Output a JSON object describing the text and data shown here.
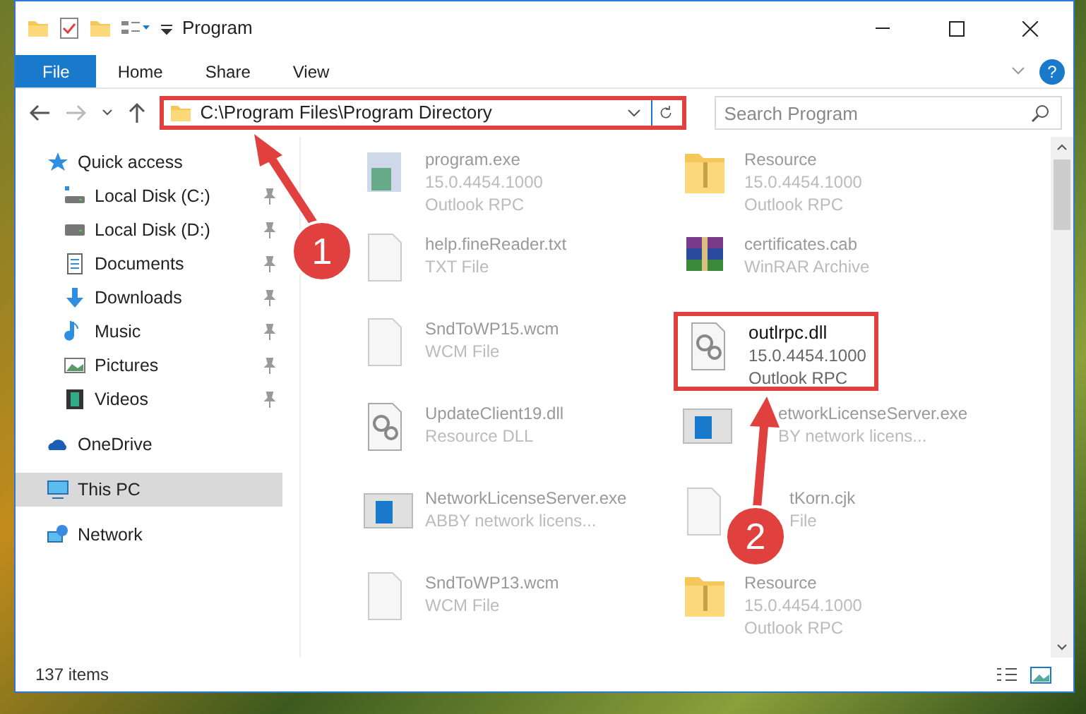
{
  "window": {
    "title": "Program"
  },
  "ribbon_tabs": [
    {
      "label": "File",
      "selected": true
    },
    {
      "label": "Home",
      "selected": false
    },
    {
      "label": "Share",
      "selected": false
    },
    {
      "label": "View",
      "selected": false
    }
  ],
  "address_bar": {
    "path": "C:\\Program Files\\Program Directory",
    "highlighted": true
  },
  "help_button": {
    "label": "?"
  },
  "search": {
    "placeholder": "Search Program"
  },
  "sidebar": {
    "items": [
      {
        "label": "Quick access",
        "selected": false,
        "children": [
          {
            "label": "Local Disk (C:)",
            "selected": false,
            "pinned": true
          },
          {
            "label": "Local Disk (D:)",
            "selected": false,
            "pinned": true
          },
          {
            "label": "Documents",
            "selected": false,
            "pinned": true
          },
          {
            "label": "Downloads",
            "selected": false,
            "pinned": true
          },
          {
            "label": "Music",
            "selected": false,
            "pinned": true
          },
          {
            "label": "Pictures",
            "selected": false,
            "pinned": true
          },
          {
            "label": "Videos",
            "selected": false,
            "pinned": true
          }
        ]
      },
      {
        "label": "OneDrive",
        "selected": false
      },
      {
        "label": "This PC",
        "selected": true
      },
      {
        "label": "Network",
        "selected": false
      }
    ]
  },
  "files": [
    {
      "name": "program.exe",
      "lines": [
        "15.0.4454.1000",
        "Outlook RPC"
      ],
      "highlighted": false
    },
    {
      "name": "Resource",
      "lines": [
        "15.0.4454.1000",
        "Outlook RPC"
      ],
      "highlighted": false
    },
    {
      "name": "help.fineReader.txt",
      "lines": [
        "TXT File"
      ],
      "highlighted": false
    },
    {
      "name": "certificates.cab",
      "lines": [
        "WinRAR Archive"
      ],
      "highlighted": false
    },
    {
      "name": "SndToWP15.wcm",
      "lines": [
        "WCM File"
      ],
      "highlighted": false
    },
    {
      "name": "outlrpc.dll",
      "lines": [
        "15.0.4454.1000",
        "Outlook RPC"
      ],
      "highlighted": true
    },
    {
      "name": "UpdateClient19.dll",
      "lines": [
        "Resource DLL"
      ],
      "highlighted": false
    },
    {
      "name": "etworkLicenseServer.exe",
      "lines": [
        "BY network licens..."
      ],
      "highlighted": false
    },
    {
      "name": "NetworkLicenseServer.exe",
      "lines": [
        "ABBY network licens..."
      ],
      "highlighted": false
    },
    {
      "name": "tKorn.cjk",
      "lines": [
        "File"
      ],
      "highlighted": false
    },
    {
      "name": "SndToWP13.wcm",
      "lines": [
        "WCM File"
      ],
      "highlighted": false
    },
    {
      "name": "Resource",
      "lines": [
        "15.0.4454.1000",
        "Outlook RPC"
      ],
      "highlighted": false
    }
  ],
  "status_bar": {
    "count": "137 items"
  },
  "annotations": [
    {
      "label": "1"
    },
    {
      "label": "2"
    }
  ]
}
